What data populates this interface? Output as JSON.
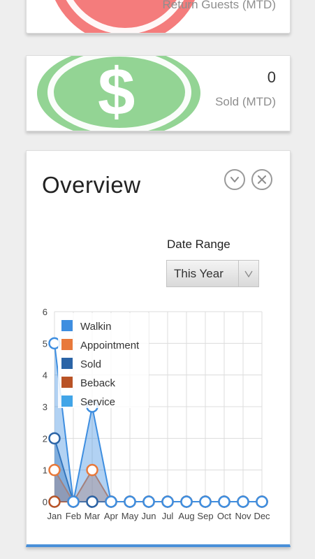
{
  "cards": {
    "return_guests": {
      "label": "Return Guests (MTD)"
    },
    "sold": {
      "value": "0",
      "label": "Sold (MTD)"
    }
  },
  "overview": {
    "title": "Overview",
    "date_range": {
      "label": "Date Range",
      "selected": "This Year"
    }
  },
  "icons": {
    "collapse": "chevron-down-icon",
    "close": "close-icon",
    "dollar": "dollar-icon",
    "select_arrow": "triangle-down-icon"
  },
  "colors": {
    "return_accent": "#f47c7c",
    "sold_accent": "#93d494",
    "card_bottom_border": "#4a90d9"
  },
  "chart_data": {
    "type": "area",
    "categories": [
      "Jan",
      "Feb",
      "Mar",
      "Apr",
      "May",
      "Jun",
      "Jul",
      "Aug",
      "Sep",
      "Oct",
      "Nov",
      "Dec"
    ],
    "ylim": [
      0,
      6
    ],
    "yticks": [
      "0",
      "1",
      "2",
      "3",
      "4",
      "5",
      "6"
    ],
    "legend": [
      "Walkin",
      "Appointment",
      "Sold",
      "Beback",
      "Service"
    ],
    "legend_placement": "top-left",
    "grid": true,
    "series": [
      {
        "name": "Walkin",
        "color": "#3e8ee0",
        "values": [
          5,
          0,
          3,
          0,
          0,
          0,
          0,
          0,
          0,
          0,
          0,
          0
        ]
      },
      {
        "name": "Appointment",
        "color": "#e8793b",
        "values": [
          1,
          0,
          1,
          0,
          0,
          0,
          0,
          0,
          0,
          0,
          0,
          0
        ]
      },
      {
        "name": "Sold",
        "color": "#2b64a6",
        "values": [
          2,
          0,
          0,
          0,
          0,
          0,
          0,
          0,
          0,
          0,
          0,
          0
        ]
      },
      {
        "name": "Beback",
        "color": "#b95326",
        "values": [
          0,
          0,
          0,
          0,
          0,
          0,
          0,
          0,
          0,
          0,
          0,
          0
        ]
      },
      {
        "name": "Service",
        "color": "#41a5e8",
        "values": [
          0,
          0,
          0,
          0,
          0,
          0,
          0,
          0,
          0,
          0,
          0,
          0
        ]
      }
    ]
  }
}
